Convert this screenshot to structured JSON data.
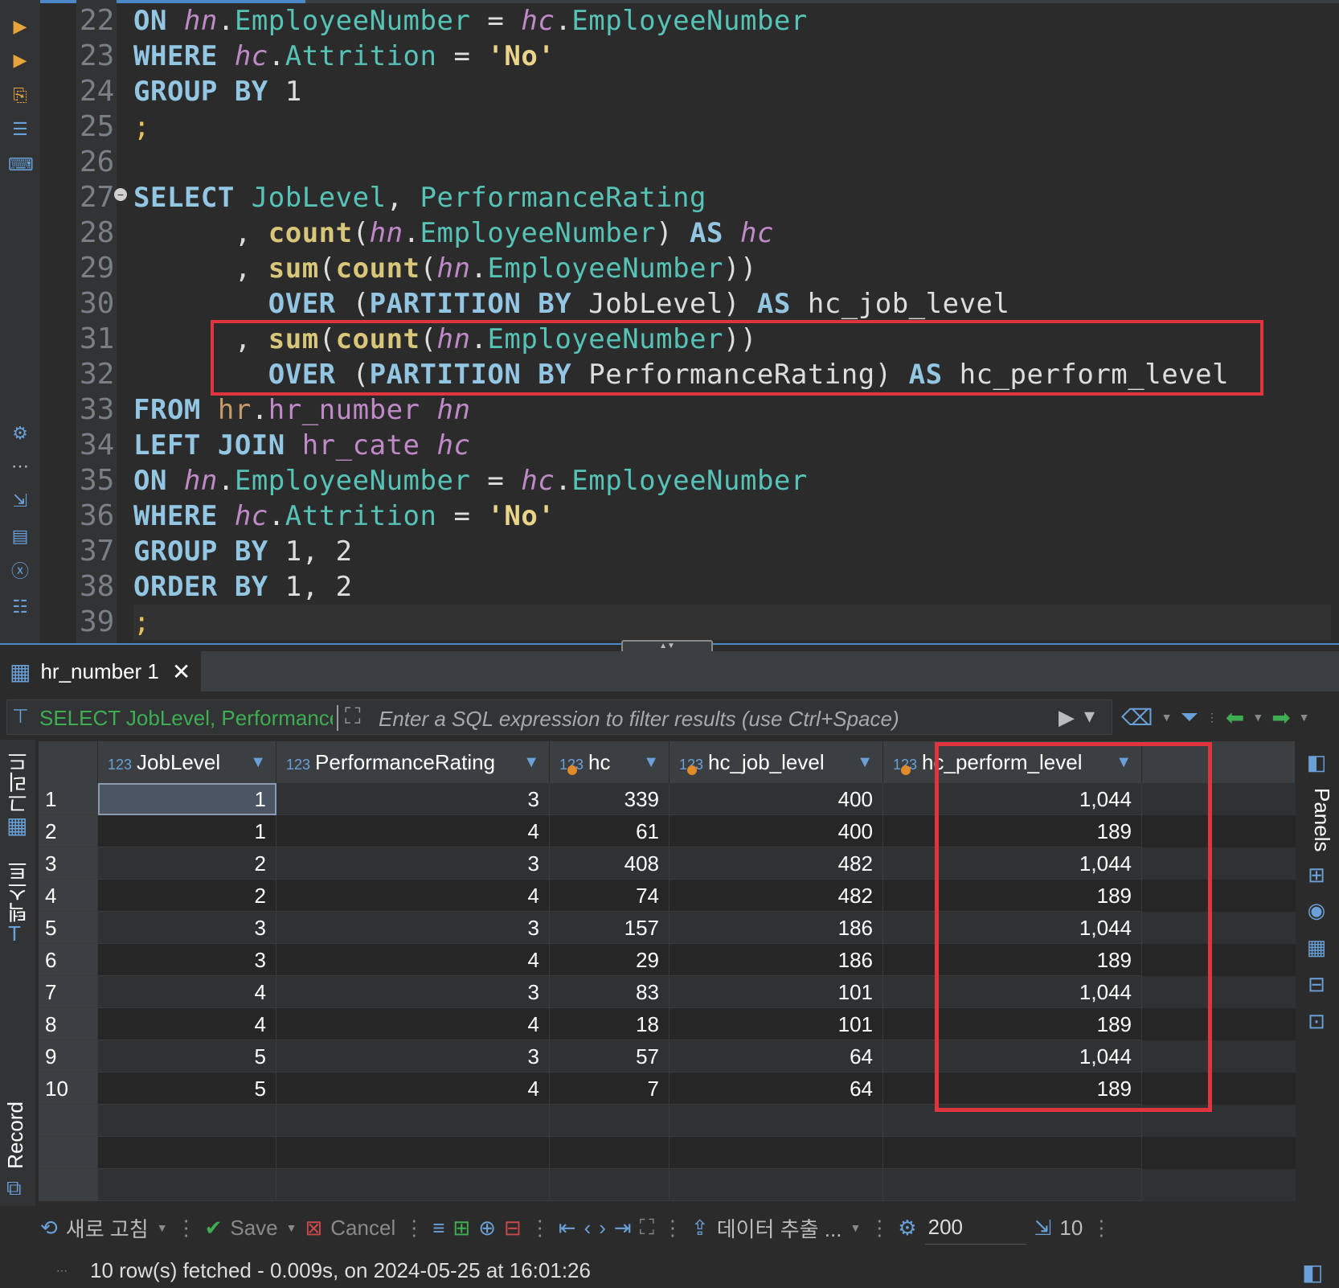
{
  "editor": {
    "line_numbers": [
      "22",
      "23",
      "24",
      "25",
      "26",
      "27",
      "28",
      "29",
      "30",
      "31",
      "32",
      "33",
      "34",
      "35",
      "36",
      "37",
      "38",
      "39"
    ],
    "lines": [
      [
        [
          "kw",
          "ON "
        ],
        [
          "al",
          "hn"
        ],
        [
          "pl",
          "."
        ],
        [
          "col",
          "EmployeeNumber"
        ],
        [
          "pl",
          " = "
        ],
        [
          "al",
          "hc"
        ],
        [
          "pl",
          "."
        ],
        [
          "col",
          "EmployeeNumber"
        ]
      ],
      [
        [
          "kw",
          "WHERE "
        ],
        [
          "al",
          "hc"
        ],
        [
          "pl",
          "."
        ],
        [
          "col",
          "Attrition"
        ],
        [
          "pl",
          " = "
        ],
        [
          "str",
          "'No'"
        ]
      ],
      [
        [
          "kw",
          "GROUP BY "
        ],
        [
          "num",
          "1"
        ]
      ],
      [
        [
          "semi",
          ";"
        ]
      ],
      [],
      [
        [
          "kw",
          "SELECT "
        ],
        [
          "col",
          "JobLevel"
        ],
        [
          "pl",
          ", "
        ],
        [
          "col",
          "PerformanceRating"
        ]
      ],
      [
        [
          "pl",
          "      , "
        ],
        [
          "fn",
          "count"
        ],
        [
          "pl",
          "("
        ],
        [
          "al",
          "hn"
        ],
        [
          "pl",
          "."
        ],
        [
          "col",
          "EmployeeNumber"
        ],
        [
          "pl",
          ") "
        ],
        [
          "kw",
          "AS "
        ],
        [
          "al",
          "hc"
        ]
      ],
      [
        [
          "pl",
          "      , "
        ],
        [
          "fn",
          "sum"
        ],
        [
          "pl",
          "("
        ],
        [
          "fn",
          "count"
        ],
        [
          "pl",
          "("
        ],
        [
          "al",
          "hn"
        ],
        [
          "pl",
          "."
        ],
        [
          "col",
          "EmployeeNumber"
        ],
        [
          "pl",
          "))"
        ]
      ],
      [
        [
          "pl",
          "        "
        ],
        [
          "kw",
          "OVER "
        ],
        [
          "pl",
          "("
        ],
        [
          "kw",
          "PARTITION BY "
        ],
        [
          "pl",
          "JobLevel) "
        ],
        [
          "kw",
          "AS "
        ],
        [
          "pl",
          "hc_job_level"
        ]
      ],
      [
        [
          "pl",
          "      , "
        ],
        [
          "fn",
          "sum"
        ],
        [
          "pl",
          "("
        ],
        [
          "fn",
          "count"
        ],
        [
          "pl",
          "("
        ],
        [
          "al",
          "hn"
        ],
        [
          "pl",
          "."
        ],
        [
          "col",
          "EmployeeNumber"
        ],
        [
          "pl",
          "))"
        ]
      ],
      [
        [
          "pl",
          "        "
        ],
        [
          "kw",
          "OVER "
        ],
        [
          "pl",
          "("
        ],
        [
          "kw",
          "PARTITION BY "
        ],
        [
          "pl",
          "PerformanceRating) "
        ],
        [
          "kw",
          "AS "
        ],
        [
          "pl",
          "hc_perform_level"
        ]
      ],
      [
        [
          "kw",
          "FROM "
        ],
        [
          "sch",
          "hr"
        ],
        [
          "pl",
          "."
        ],
        [
          "tbl",
          "hr_number "
        ],
        [
          "al",
          "hn"
        ]
      ],
      [
        [
          "kw",
          "LEFT JOIN "
        ],
        [
          "tbl",
          "hr_cate "
        ],
        [
          "al",
          "hc"
        ]
      ],
      [
        [
          "kw",
          "ON "
        ],
        [
          "al",
          "hn"
        ],
        [
          "pl",
          "."
        ],
        [
          "col",
          "EmployeeNumber"
        ],
        [
          "pl",
          " = "
        ],
        [
          "al",
          "hc"
        ],
        [
          "pl",
          "."
        ],
        [
          "col",
          "EmployeeNumber"
        ]
      ],
      [
        [
          "kw",
          "WHERE "
        ],
        [
          "al",
          "hc"
        ],
        [
          "pl",
          "."
        ],
        [
          "col",
          "Attrition"
        ],
        [
          "pl",
          " = "
        ],
        [
          "str",
          "'No'"
        ]
      ],
      [
        [
          "kw",
          "GROUP BY "
        ],
        [
          "num",
          "1, 2"
        ]
      ],
      [
        [
          "kw",
          "ORDER BY "
        ],
        [
          "num",
          "1, 2"
        ]
      ],
      [
        [
          "semi",
          ";"
        ]
      ]
    ],
    "left_icons": [
      "run-statement-icon",
      "run-script-icon",
      "explain-plan-icon",
      "load-script-icon",
      "terminal-icon",
      "settings-icon",
      "more-icon",
      "export-icon",
      "error-file-icon",
      "variables-icon",
      "outline-icon"
    ]
  },
  "result": {
    "tab_label": "hr_number 1",
    "filter_query": "SELECT JobLevel, PerformanceRating",
    "filter_placeholder": "Enter a SQL expression to filter results (use Ctrl+Space)",
    "left_tabs": [
      "그리드",
      "텍스트",
      "Record"
    ],
    "right_tab": "Panels",
    "columns": [
      {
        "type": "123",
        "name": "JobLevel",
        "key": false
      },
      {
        "type": "123",
        "name": "PerformanceRating",
        "key": false
      },
      {
        "type": "123",
        "name": "hc",
        "key": true
      },
      {
        "type": "123",
        "name": "hc_job_level",
        "key": true
      },
      {
        "type": "123",
        "name": "hc_perform_level",
        "key": true
      }
    ],
    "rows": [
      [
        "1",
        "1",
        "3",
        "339",
        "400",
        "1,044"
      ],
      [
        "2",
        "1",
        "4",
        "61",
        "400",
        "189"
      ],
      [
        "3",
        "2",
        "3",
        "408",
        "482",
        "1,044"
      ],
      [
        "4",
        "2",
        "4",
        "74",
        "482",
        "189"
      ],
      [
        "5",
        "3",
        "3",
        "157",
        "186",
        "1,044"
      ],
      [
        "6",
        "3",
        "4",
        "29",
        "186",
        "189"
      ],
      [
        "7",
        "4",
        "3",
        "83",
        "101",
        "1,044"
      ],
      [
        "8",
        "4",
        "4",
        "18",
        "101",
        "189"
      ],
      [
        "9",
        "5",
        "3",
        "57",
        "64",
        "1,044"
      ],
      [
        "10",
        "5",
        "4",
        "7",
        "64",
        "189"
      ]
    ]
  },
  "toolbar": {
    "refresh_label": "새로 고침",
    "save_label": "Save",
    "cancel_label": "Cancel",
    "export_label": "데이터 추출 ...",
    "fetch_size": "200",
    "row_count": "10"
  },
  "status": {
    "text": "10 row(s) fetched - 0.009s, on 2024-05-25 at 16:01:26"
  }
}
